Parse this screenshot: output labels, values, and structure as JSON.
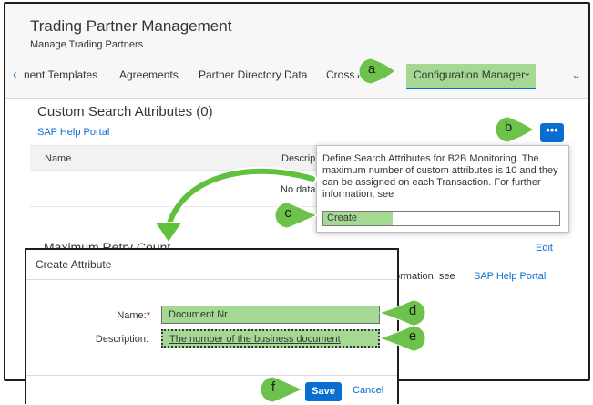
{
  "header": {
    "title": "Trading Partner Management",
    "subtitle": "Manage Trading Partners"
  },
  "tabs": {
    "items": [
      "nent Templates",
      "Agreements",
      "Partner Directory Data",
      "Cross A"
    ],
    "active": "Configuration Manager"
  },
  "section": {
    "title": "Custom Search Attributes (0)",
    "help_link": "SAP Help Portal",
    "more_button": "•••"
  },
  "table": {
    "columns": [
      "Name",
      "Descrip"
    ],
    "empty_text": "No data"
  },
  "retry": {
    "title": "Maximum Retry Count",
    "edit": "Edit",
    "info_text": "ormation, see",
    "info_link": "SAP Help Portal"
  },
  "popover": {
    "text": "Define Search Attributes for B2B Monitoring. The maximum number of custom attributes is 10 and they can be assigned on each Transaction. For further information, see",
    "item": "Create"
  },
  "dialog": {
    "title": "Create Attribute",
    "name_label": "Name:",
    "name_required": "*",
    "name_value": "Document Nr.",
    "description_label": "Description:",
    "description_value": "The number of the business document",
    "save": "Save",
    "cancel": "Cancel"
  },
  "annotations": {
    "a": "a",
    "b": "b",
    "c": "c",
    "d": "d",
    "e": "e",
    "f": "f"
  },
  "colors": {
    "highlight": "#a5d993",
    "badge": "#6cc24a",
    "arrow": "#5fc13c",
    "accent": "#0a6ed1"
  }
}
